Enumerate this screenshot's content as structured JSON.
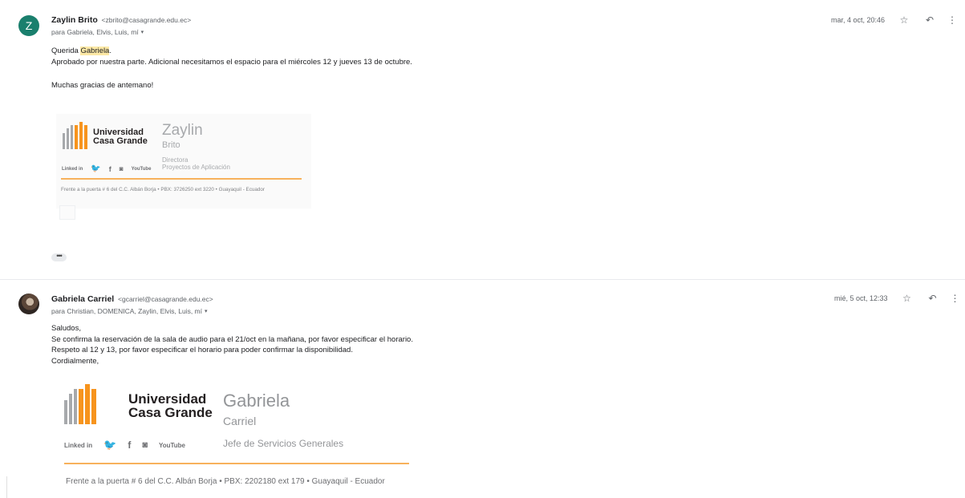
{
  "messages": [
    {
      "avatar_letter": "Z",
      "sender_name": "Zaylin Brito",
      "sender_email": "<zbrito@casagrande.edu.ec>",
      "recipients": "para Gabriela, Elvis, Luis, mí",
      "date": "mar, 4 oct, 20:46",
      "greeting_prefix": "Querida ",
      "greeting_name": "Gabriela",
      "greeting_suffix": ".",
      "lines": [
        "Aprobado por nuestra parte. Adicional necesitamos el espacio para el miércoles 12 y jueves 13 de octubre."
      ],
      "closing": "Muchas gracias de antemano!",
      "signature": {
        "university_line1": "Universidad",
        "university_line2": "Casa Grande",
        "first_name": "Zaylin",
        "last_name": "Brito",
        "role_line1": "Directora",
        "role_line2": "Proyectos de Aplicación",
        "social": [
          "Linked in",
          "twitter",
          "f",
          "instagram",
          "YouTube"
        ],
        "address": "Frente a la puerta # 6 del C.C. Albán Borja  •  PBX: 3726250 ext 3220  •  Guayaquil - Ecuador"
      },
      "show_trimmed": "•••"
    },
    {
      "sender_name": "Gabriela Carriel",
      "sender_email": "<gcarriel@casagrande.edu.ec>",
      "recipients": "para Christian, DOMENICA, Zaylin, Elvis, Luis, mí",
      "date": "mié, 5 oct, 12:33",
      "lines": [
        "Saludos,",
        "Se confirma la reservación de la sala de audio para el 21/oct en la mañana, por favor especificar el horario.",
        "Respeto al 12 y 13, por favor especificar el horario para poder confirmar la disponibilidad.",
        "Cordialmente,"
      ],
      "signature": {
        "university_line1": "Universidad",
        "university_line2": "Casa Grande",
        "first_name": "Gabriela",
        "last_name": "Carriel",
        "role_line1": "Jefe de Servicios Generales",
        "social": [
          "Linked in",
          "twitter",
          "f",
          "instagram",
          "YouTube"
        ],
        "address": "Frente a la puerta # 6 del C.C. Albán Borja  •  PBX: 2202180 ext 179  •  Guayaquil - Ecuador"
      }
    }
  ],
  "icons": {
    "star": "☆",
    "reply": "↶",
    "more": "⋮",
    "caret": "▾"
  },
  "colors": {
    "avatar_z": "#1a7f6d",
    "highlight": "#fce8a5",
    "orange": "#f7941d",
    "gray_logo": "#a7a9ac"
  }
}
